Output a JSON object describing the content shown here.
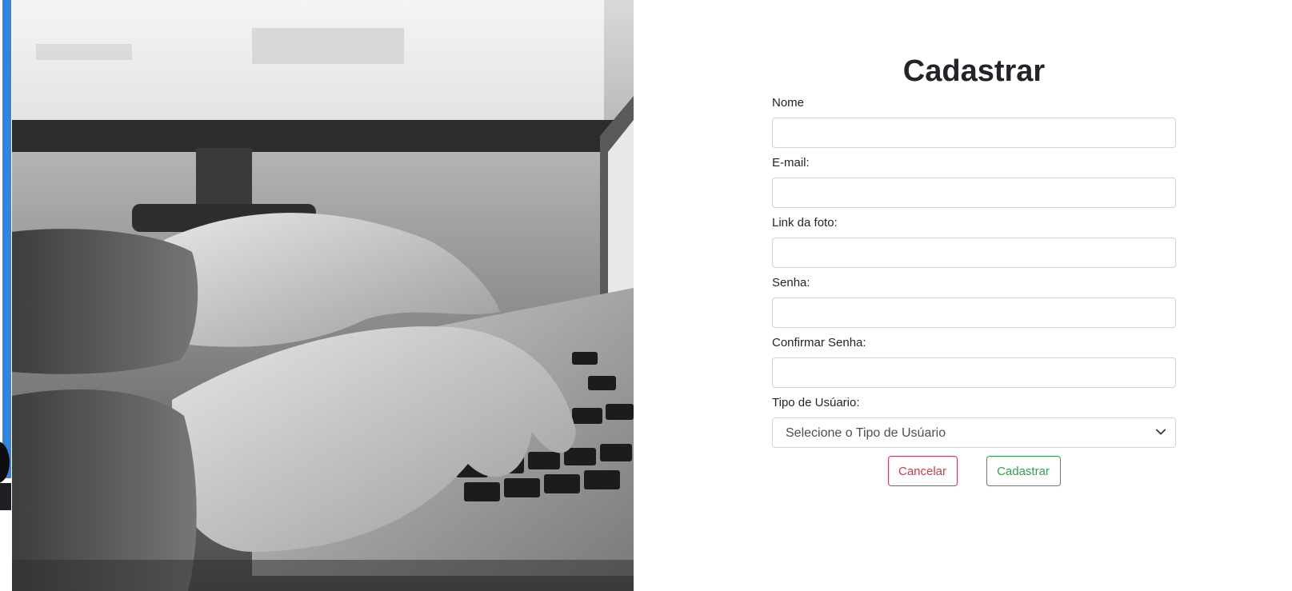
{
  "form": {
    "title": "Cadastrar",
    "fields": [
      {
        "label": "Nome",
        "value": "",
        "type": "text"
      },
      {
        "label": "E-mail:",
        "value": "",
        "type": "email"
      },
      {
        "label": "Link da foto:",
        "value": "",
        "type": "text"
      },
      {
        "label": "Senha:",
        "value": "",
        "type": "password"
      },
      {
        "label": "Confirmar Senha:",
        "value": "",
        "type": "password"
      }
    ],
    "user_type": {
      "label": "Tipo de Usúario:",
      "selected": "Selecione o Tipo de Usúario"
    },
    "buttons": {
      "cancel_label": "Cancelar",
      "submit_label": "Cadastrar"
    }
  },
  "colors": {
    "cancel": "#dc3545",
    "submit": "#28a745",
    "edge_blue": "#2f86e0"
  },
  "icons": {
    "select_caret": "chevron-down-icon"
  }
}
